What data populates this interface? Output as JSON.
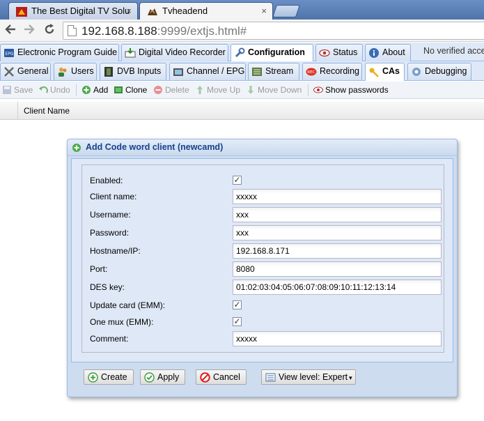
{
  "browser": {
    "tabs": [
      {
        "title": "The Best Digital TV Solu",
        "active": false,
        "icon": "tvh-red-icon"
      },
      {
        "title": "Tvheadend",
        "active": true,
        "icon": "tvheadend-icon"
      }
    ],
    "url_host": "192.168.8.188",
    "url_rest": ":9999/extjs.html#",
    "close_glyph": "×"
  },
  "topnav": {
    "tabs": [
      {
        "label": "Electronic Program Guide",
        "icon": "epg-icon"
      },
      {
        "label": "Digital Video Recorder",
        "icon": "dvr-icon"
      },
      {
        "label": "Configuration",
        "icon": "wrench-icon",
        "active": true
      },
      {
        "label": "Status",
        "icon": "eye-icon"
      },
      {
        "label": "About",
        "icon": "info-icon"
      }
    ],
    "verified_text": "No verified acce"
  },
  "subnav": {
    "tabs": [
      {
        "label": "General",
        "icon": "tools-icon"
      },
      {
        "label": "Users",
        "icon": "users-icon"
      },
      {
        "label": "DVB Inputs",
        "icon": "film-icon"
      },
      {
        "label": "Channel / EPG",
        "icon": "tv-icon"
      },
      {
        "label": "Stream",
        "icon": "stream-icon"
      },
      {
        "label": "Recording",
        "icon": "rec-icon"
      },
      {
        "label": "CAs",
        "icon": "key-icon",
        "active": true
      },
      {
        "label": "Debugging",
        "icon": "debug-icon"
      }
    ]
  },
  "grid_toolbar": {
    "save": "Save",
    "undo": "Undo",
    "add": "Add",
    "clone": "Clone",
    "delete": "Delete",
    "move_up": "Move Up",
    "move_down": "Move Down",
    "show_passwords": "Show passwords"
  },
  "grid": {
    "column": "Client Name"
  },
  "dialog": {
    "title": "Add Code word client (newcamd)",
    "fields": [
      {
        "label": "Enabled:",
        "type": "checkbox",
        "checked": true
      },
      {
        "label": "Client name:",
        "type": "text",
        "value": "xxxxx"
      },
      {
        "label": "Username:",
        "type": "text",
        "value": "xxx"
      },
      {
        "label": "Password:",
        "type": "text",
        "value": "xxx"
      },
      {
        "label": "Hostname/IP:",
        "type": "text",
        "value": "192.168.8.171"
      },
      {
        "label": "Port:",
        "type": "text",
        "value": "8080"
      },
      {
        "label": "DES key:",
        "type": "text",
        "value": "01:02:03:04:05:06:07:08:09:10:11:12:13:14"
      },
      {
        "label": "Update card (EMM):",
        "type": "checkbox",
        "checked": true
      },
      {
        "label": "One mux (EMM):",
        "type": "checkbox",
        "checked": true
      },
      {
        "label": "Comment:",
        "type": "text",
        "value": "xxxxx"
      }
    ],
    "check_glyph": "✓",
    "buttons": {
      "create": "Create",
      "apply": "Apply",
      "cancel": "Cancel",
      "view_level": "View level: Expert"
    }
  }
}
